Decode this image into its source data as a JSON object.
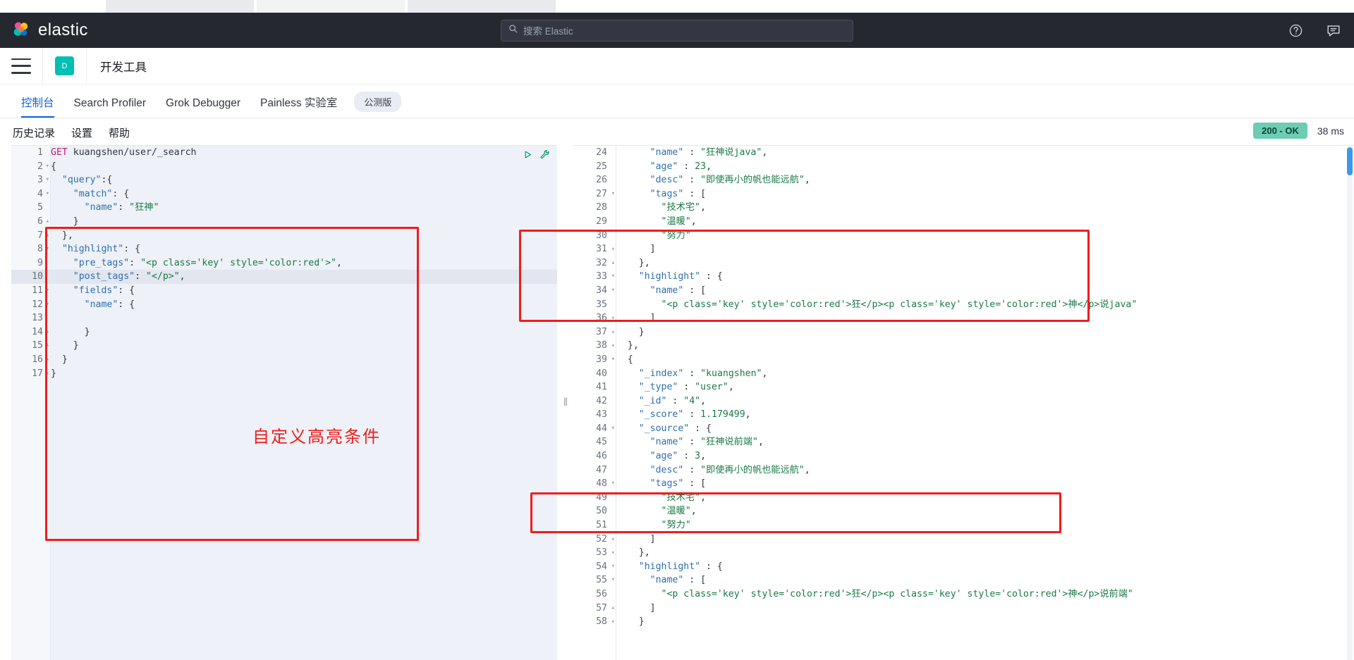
{
  "browser": {
    "tabs": [
      "",
      "",
      ""
    ],
    "right_icons": [
      "minimize-icon",
      "restore-icon",
      "close-icon"
    ]
  },
  "header": {
    "brand": "elastic",
    "search_placeholder": "搜索 Elastic",
    "search_icon": "search-icon",
    "help_icon": "help-circle-icon",
    "feedback_icon": "feedback-icon"
  },
  "appbar": {
    "menu_icon": "hamburger-menu-icon",
    "avatar_letter": "D",
    "title": "开发工具"
  },
  "tabs": [
    {
      "label": "控制台",
      "active": true
    },
    {
      "label": "Search Profiler",
      "active": false
    },
    {
      "label": "Grok Debugger",
      "active": false
    },
    {
      "label": "Painless 实验室",
      "active": false
    }
  ],
  "beta_badge": "公测版",
  "toolbar": {
    "history": "历史记录",
    "settings": "设置",
    "help": "帮助"
  },
  "status": {
    "code": "200 - OK",
    "time": "38 ms",
    "ok_color": "#6dccb1"
  },
  "request_editor": {
    "run_icon": "play-triangle-icon",
    "wrench_icon": "wrench-icon",
    "highlighted_line": 10,
    "lines": [
      {
        "n": 1,
        "fold": "",
        "tokens": [
          {
            "t": "method",
            "v": "GET"
          },
          {
            "t": "plain",
            "v": " "
          },
          {
            "t": "url",
            "v": "kuangshen/user/_search"
          }
        ]
      },
      {
        "n": 2,
        "fold": "▾",
        "tokens": [
          {
            "t": "punc",
            "v": "{"
          }
        ]
      },
      {
        "n": 3,
        "fold": "▾",
        "tokens": [
          {
            "t": "plain",
            "v": "  "
          },
          {
            "t": "key",
            "v": "\"query\""
          },
          {
            "t": "punc",
            "v": ":{"
          }
        ]
      },
      {
        "n": 4,
        "fold": "▾",
        "tokens": [
          {
            "t": "plain",
            "v": "    "
          },
          {
            "t": "key",
            "v": "\"match\""
          },
          {
            "t": "punc",
            "v": ": {"
          }
        ]
      },
      {
        "n": 5,
        "fold": "",
        "tokens": [
          {
            "t": "plain",
            "v": "      "
          },
          {
            "t": "key",
            "v": "\"name\""
          },
          {
            "t": "punc",
            "v": ": "
          },
          {
            "t": "str",
            "v": "\"狂神\""
          }
        ]
      },
      {
        "n": 6,
        "fold": "▴",
        "tokens": [
          {
            "t": "plain",
            "v": "    "
          },
          {
            "t": "punc",
            "v": "}"
          }
        ]
      },
      {
        "n": 7,
        "fold": "▴",
        "tokens": [
          {
            "t": "plain",
            "v": "  "
          },
          {
            "t": "punc",
            "v": "},"
          }
        ]
      },
      {
        "n": 8,
        "fold": "▾",
        "tokens": [
          {
            "t": "plain",
            "v": "  "
          },
          {
            "t": "key",
            "v": "\"highlight\""
          },
          {
            "t": "punc",
            "v": ": {"
          }
        ]
      },
      {
        "n": 9,
        "fold": "",
        "tokens": [
          {
            "t": "plain",
            "v": "    "
          },
          {
            "t": "key",
            "v": "\"pre_tags\""
          },
          {
            "t": "punc",
            "v": ": "
          },
          {
            "t": "str",
            "v": "\"<p class='key' style='color:red'>\""
          },
          {
            "t": "punc",
            "v": ","
          }
        ]
      },
      {
        "n": 10,
        "fold": "",
        "tokens": [
          {
            "t": "plain",
            "v": "    "
          },
          {
            "t": "key",
            "v": "\"post_tags\""
          },
          {
            "t": "punc",
            "v": ": "
          },
          {
            "t": "str",
            "v": "\"</p>\""
          },
          {
            "t": "punc",
            "v": ","
          }
        ]
      },
      {
        "n": 11,
        "fold": "▾",
        "tokens": [
          {
            "t": "plain",
            "v": "    "
          },
          {
            "t": "key",
            "v": "\"fields\""
          },
          {
            "t": "punc",
            "v": ": {"
          }
        ]
      },
      {
        "n": 12,
        "fold": "▾",
        "tokens": [
          {
            "t": "plain",
            "v": "      "
          },
          {
            "t": "key",
            "v": "\"name\""
          },
          {
            "t": "punc",
            "v": ": {"
          }
        ]
      },
      {
        "n": 13,
        "fold": "",
        "tokens": [
          {
            "t": "plain",
            "v": "        "
          }
        ]
      },
      {
        "n": 14,
        "fold": "▴",
        "tokens": [
          {
            "t": "plain",
            "v": "      "
          },
          {
            "t": "punc",
            "v": "}"
          }
        ]
      },
      {
        "n": 15,
        "fold": "▴",
        "tokens": [
          {
            "t": "plain",
            "v": "    "
          },
          {
            "t": "punc",
            "v": "}"
          }
        ]
      },
      {
        "n": 16,
        "fold": "▴",
        "tokens": [
          {
            "t": "plain",
            "v": "  "
          },
          {
            "t": "punc",
            "v": "}"
          }
        ]
      },
      {
        "n": 17,
        "fold": "▴",
        "tokens": [
          {
            "t": "punc",
            "v": "}"
          }
        ]
      }
    ]
  },
  "response_viewer": {
    "lines": [
      {
        "n": 24,
        "fold": "",
        "tokens": [
          {
            "t": "plain",
            "v": "      "
          },
          {
            "t": "key",
            "v": "\"name\""
          },
          {
            "t": "punc",
            "v": " : "
          },
          {
            "t": "str",
            "v": "\"狂神说java\""
          },
          {
            "t": "punc",
            "v": ","
          }
        ]
      },
      {
        "n": 25,
        "fold": "",
        "tokens": [
          {
            "t": "plain",
            "v": "      "
          },
          {
            "t": "key",
            "v": "\"age\""
          },
          {
            "t": "punc",
            "v": " : "
          },
          {
            "t": "num",
            "v": "23"
          },
          {
            "t": "punc",
            "v": ","
          }
        ]
      },
      {
        "n": 26,
        "fold": "",
        "tokens": [
          {
            "t": "plain",
            "v": "      "
          },
          {
            "t": "key",
            "v": "\"desc\""
          },
          {
            "t": "punc",
            "v": " : "
          },
          {
            "t": "str",
            "v": "\"即使再小的帆也能远航\""
          },
          {
            "t": "punc",
            "v": ","
          }
        ]
      },
      {
        "n": 27,
        "fold": "▾",
        "tokens": [
          {
            "t": "plain",
            "v": "      "
          },
          {
            "t": "key",
            "v": "\"tags\""
          },
          {
            "t": "punc",
            "v": " : ["
          }
        ]
      },
      {
        "n": 28,
        "fold": "",
        "tokens": [
          {
            "t": "plain",
            "v": "        "
          },
          {
            "t": "str",
            "v": "\"技术宅\""
          },
          {
            "t": "punc",
            "v": ","
          }
        ]
      },
      {
        "n": 29,
        "fold": "",
        "tokens": [
          {
            "t": "plain",
            "v": "        "
          },
          {
            "t": "str",
            "v": "\"温暖\""
          },
          {
            "t": "punc",
            "v": ","
          }
        ]
      },
      {
        "n": 30,
        "fold": "",
        "tokens": [
          {
            "t": "plain",
            "v": "        "
          },
          {
            "t": "str",
            "v": "\"努力\""
          }
        ]
      },
      {
        "n": 31,
        "fold": "▴",
        "tokens": [
          {
            "t": "plain",
            "v": "      "
          },
          {
            "t": "punc",
            "v": "]"
          }
        ]
      },
      {
        "n": 32,
        "fold": "▴",
        "tokens": [
          {
            "t": "plain",
            "v": "    "
          },
          {
            "t": "punc",
            "v": "},"
          }
        ]
      },
      {
        "n": 33,
        "fold": "▾",
        "tokens": [
          {
            "t": "plain",
            "v": "    "
          },
          {
            "t": "key",
            "v": "\"highlight\""
          },
          {
            "t": "punc",
            "v": " : {"
          }
        ]
      },
      {
        "n": 34,
        "fold": "▾",
        "tokens": [
          {
            "t": "plain",
            "v": "      "
          },
          {
            "t": "key",
            "v": "\"name\""
          },
          {
            "t": "punc",
            "v": " : ["
          }
        ]
      },
      {
        "n": 35,
        "fold": "",
        "tokens": [
          {
            "t": "plain",
            "v": "        "
          },
          {
            "t": "str",
            "v": "\"<p class='key' style='color:red'>狂</p><p class='key' style='color:red'>神</p>说java\""
          }
        ]
      },
      {
        "n": 36,
        "fold": "▴",
        "tokens": [
          {
            "t": "plain",
            "v": "      "
          },
          {
            "t": "punc",
            "v": "]"
          }
        ]
      },
      {
        "n": 37,
        "fold": "▴",
        "tokens": [
          {
            "t": "plain",
            "v": "    "
          },
          {
            "t": "punc",
            "v": "}"
          }
        ]
      },
      {
        "n": 38,
        "fold": "▴",
        "tokens": [
          {
            "t": "plain",
            "v": "  "
          },
          {
            "t": "punc",
            "v": "},"
          }
        ]
      },
      {
        "n": 39,
        "fold": "▾",
        "tokens": [
          {
            "t": "plain",
            "v": "  "
          },
          {
            "t": "punc",
            "v": "{"
          }
        ]
      },
      {
        "n": 40,
        "fold": "",
        "tokens": [
          {
            "t": "plain",
            "v": "    "
          },
          {
            "t": "key",
            "v": "\"_index\""
          },
          {
            "t": "punc",
            "v": " : "
          },
          {
            "t": "str",
            "v": "\"kuangshen\""
          },
          {
            "t": "punc",
            "v": ","
          }
        ]
      },
      {
        "n": 41,
        "fold": "",
        "tokens": [
          {
            "t": "plain",
            "v": "    "
          },
          {
            "t": "key",
            "v": "\"_type\""
          },
          {
            "t": "punc",
            "v": " : "
          },
          {
            "t": "str",
            "v": "\"user\""
          },
          {
            "t": "punc",
            "v": ","
          }
        ]
      },
      {
        "n": 42,
        "fold": "",
        "tokens": [
          {
            "t": "plain",
            "v": "    "
          },
          {
            "t": "key",
            "v": "\"_id\""
          },
          {
            "t": "punc",
            "v": " : "
          },
          {
            "t": "str",
            "v": "\"4\""
          },
          {
            "t": "punc",
            "v": ","
          }
        ]
      },
      {
        "n": 43,
        "fold": "",
        "tokens": [
          {
            "t": "plain",
            "v": "    "
          },
          {
            "t": "key",
            "v": "\"_score\""
          },
          {
            "t": "punc",
            "v": " : "
          },
          {
            "t": "num",
            "v": "1.179499"
          },
          {
            "t": "punc",
            "v": ","
          }
        ]
      },
      {
        "n": 44,
        "fold": "▾",
        "tokens": [
          {
            "t": "plain",
            "v": "    "
          },
          {
            "t": "key",
            "v": "\"_source\""
          },
          {
            "t": "punc",
            "v": " : {"
          }
        ]
      },
      {
        "n": 45,
        "fold": "",
        "tokens": [
          {
            "t": "plain",
            "v": "      "
          },
          {
            "t": "key",
            "v": "\"name\""
          },
          {
            "t": "punc",
            "v": " : "
          },
          {
            "t": "str",
            "v": "\"狂神说前端\""
          },
          {
            "t": "punc",
            "v": ","
          }
        ]
      },
      {
        "n": 46,
        "fold": "",
        "tokens": [
          {
            "t": "plain",
            "v": "      "
          },
          {
            "t": "key",
            "v": "\"age\""
          },
          {
            "t": "punc",
            "v": " : "
          },
          {
            "t": "num",
            "v": "3"
          },
          {
            "t": "punc",
            "v": ","
          }
        ]
      },
      {
        "n": 47,
        "fold": "",
        "tokens": [
          {
            "t": "plain",
            "v": "      "
          },
          {
            "t": "key",
            "v": "\"desc\""
          },
          {
            "t": "punc",
            "v": " : "
          },
          {
            "t": "str",
            "v": "\"即使再小的帆也能远航\""
          },
          {
            "t": "punc",
            "v": ","
          }
        ]
      },
      {
        "n": 48,
        "fold": "▾",
        "tokens": [
          {
            "t": "plain",
            "v": "      "
          },
          {
            "t": "key",
            "v": "\"tags\""
          },
          {
            "t": "punc",
            "v": " : ["
          }
        ]
      },
      {
        "n": 49,
        "fold": "",
        "tokens": [
          {
            "t": "plain",
            "v": "        "
          },
          {
            "t": "str",
            "v": "\"技术宅\""
          },
          {
            "t": "punc",
            "v": ","
          }
        ]
      },
      {
        "n": 50,
        "fold": "",
        "tokens": [
          {
            "t": "plain",
            "v": "        "
          },
          {
            "t": "str",
            "v": "\"温暖\""
          },
          {
            "t": "punc",
            "v": ","
          }
        ]
      },
      {
        "n": 51,
        "fold": "",
        "tokens": [
          {
            "t": "plain",
            "v": "        "
          },
          {
            "t": "str",
            "v": "\"努力\""
          }
        ]
      },
      {
        "n": 52,
        "fold": "▴",
        "tokens": [
          {
            "t": "plain",
            "v": "      "
          },
          {
            "t": "punc",
            "v": "]"
          }
        ]
      },
      {
        "n": 53,
        "fold": "▴",
        "tokens": [
          {
            "t": "plain",
            "v": "    "
          },
          {
            "t": "punc",
            "v": "},"
          }
        ]
      },
      {
        "n": 54,
        "fold": "▾",
        "tokens": [
          {
            "t": "plain",
            "v": "    "
          },
          {
            "t": "key",
            "v": "\"highlight\""
          },
          {
            "t": "punc",
            "v": " : {"
          }
        ]
      },
      {
        "n": 55,
        "fold": "▾",
        "tokens": [
          {
            "t": "plain",
            "v": "      "
          },
          {
            "t": "key",
            "v": "\"name\""
          },
          {
            "t": "punc",
            "v": " : ["
          }
        ]
      },
      {
        "n": 56,
        "fold": "",
        "tokens": [
          {
            "t": "plain",
            "v": "        "
          },
          {
            "t": "str",
            "v": "\"<p class='key' style='color:red'>狂</p><p class='key' style='color:red'>神</p>说前端\""
          }
        ]
      },
      {
        "n": 57,
        "fold": "▴",
        "tokens": [
          {
            "t": "plain",
            "v": "      "
          },
          {
            "t": "punc",
            "v": "]"
          }
        ]
      },
      {
        "n": 58,
        "fold": "▴",
        "tokens": [
          {
            "t": "plain",
            "v": "    "
          },
          {
            "t": "punc",
            "v": "}"
          }
        ]
      }
    ]
  },
  "annotations": {
    "note_text": "自定义高亮条件",
    "color": "#ef1d1d"
  }
}
